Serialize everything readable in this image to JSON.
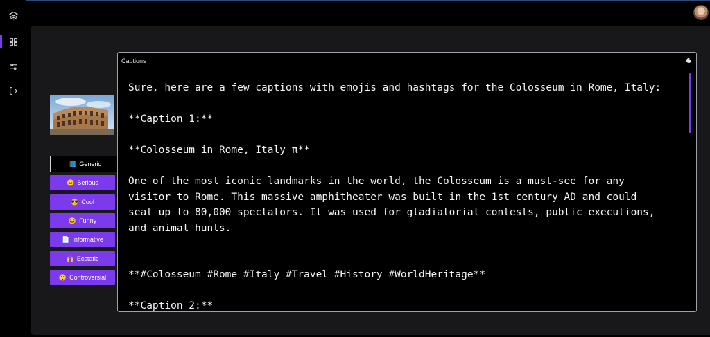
{
  "sidebar": {
    "items": [
      {
        "icon": "layers-icon"
      },
      {
        "icon": "grid-icon"
      },
      {
        "icon": "sliders-icon"
      },
      {
        "icon": "logout-icon"
      }
    ],
    "active_index": 1
  },
  "header": {
    "avatar": "user-avatar"
  },
  "tones": [
    {
      "emoji": "📘",
      "label": "Generic"
    },
    {
      "emoji": "😑",
      "label": "Serious"
    },
    {
      "emoji": "😎",
      "label": "Cool"
    },
    {
      "emoji": "😂",
      "label": "Funny"
    },
    {
      "emoji": "📄",
      "label": "Informative"
    },
    {
      "emoji": "🙌",
      "label": "Ecstatic"
    },
    {
      "emoji": "😲",
      "label": "Controversial"
    }
  ],
  "selected_tone": "Generic",
  "panel": {
    "title": "Captions",
    "text": "Sure, here are a few captions with emojis and hashtags for the Colosseum in Rome, Italy:\n\n**Caption 1:**\n\n**Colosseum in Rome, Italy π**\n\nOne of the most iconic landmarks in the world, the Colosseum is a must-see for any\nvisitor to Rome. This massive amphitheater was built in the 1st century AD and could\nseat up to 80,000 spectators. It was used for gladiatorial contests, public executions,\nand animal hunts.\n\n\n**#Colosseum #Rome #Italy #Travel #History #WorldHeritage**\n\n**Caption 2:**"
  },
  "colors": {
    "accent": "#7c3aed",
    "background": "#000000",
    "surface": "#18181b"
  }
}
